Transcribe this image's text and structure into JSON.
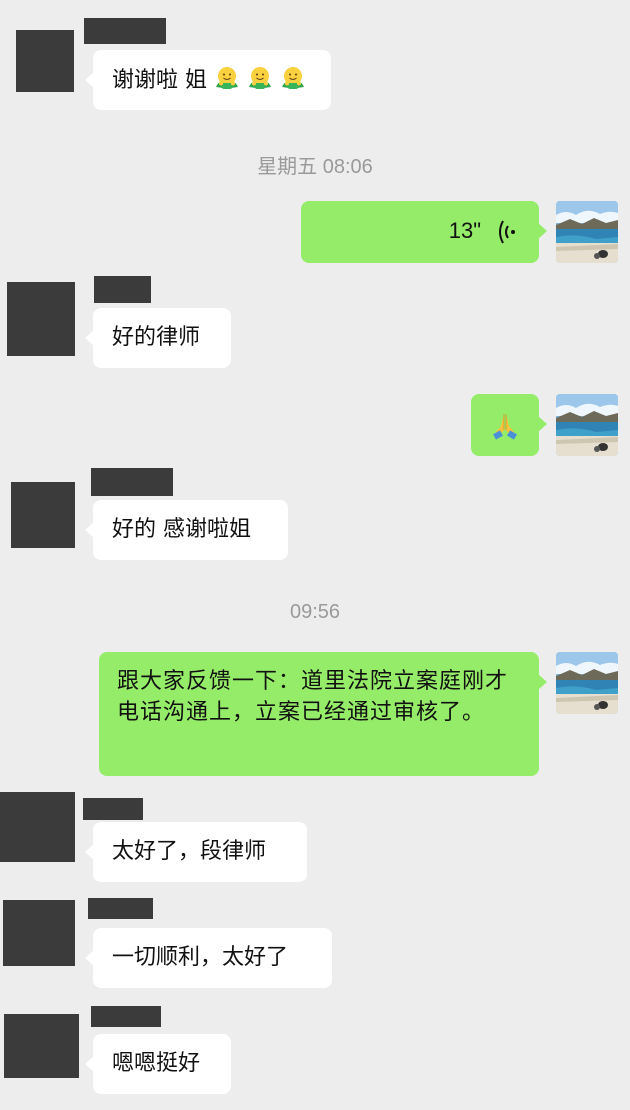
{
  "messages": [
    {
      "text": "谢谢啦 姐",
      "emoji_names": [
        "hugging-emoji",
        "hugging-emoji",
        "hugging-emoji"
      ]
    },
    {
      "timestamp": "星期五 08:06"
    },
    {
      "voice_duration": "13\""
    },
    {
      "text": "好的律师"
    },
    {
      "emoji_name": "folded-hands-emoji"
    },
    {
      "text": "好的 感谢啦姐"
    },
    {
      "timestamp": "09:56"
    },
    {
      "text": "跟大家反馈一下：道里法院立案庭刚才电话沟通上，立案已经通过审核了。"
    },
    {
      "text": "太好了，段律师"
    },
    {
      "text": "一切顺利，太好了"
    },
    {
      "text": "嗯嗯挺好"
    }
  ],
  "colors": {
    "background": "#ededed",
    "incoming_bubble": "#ffffff",
    "outgoing_bubble": "#95ec69",
    "redaction": "#3b3b3b",
    "timestamp_text": "#9a9a9a"
  }
}
